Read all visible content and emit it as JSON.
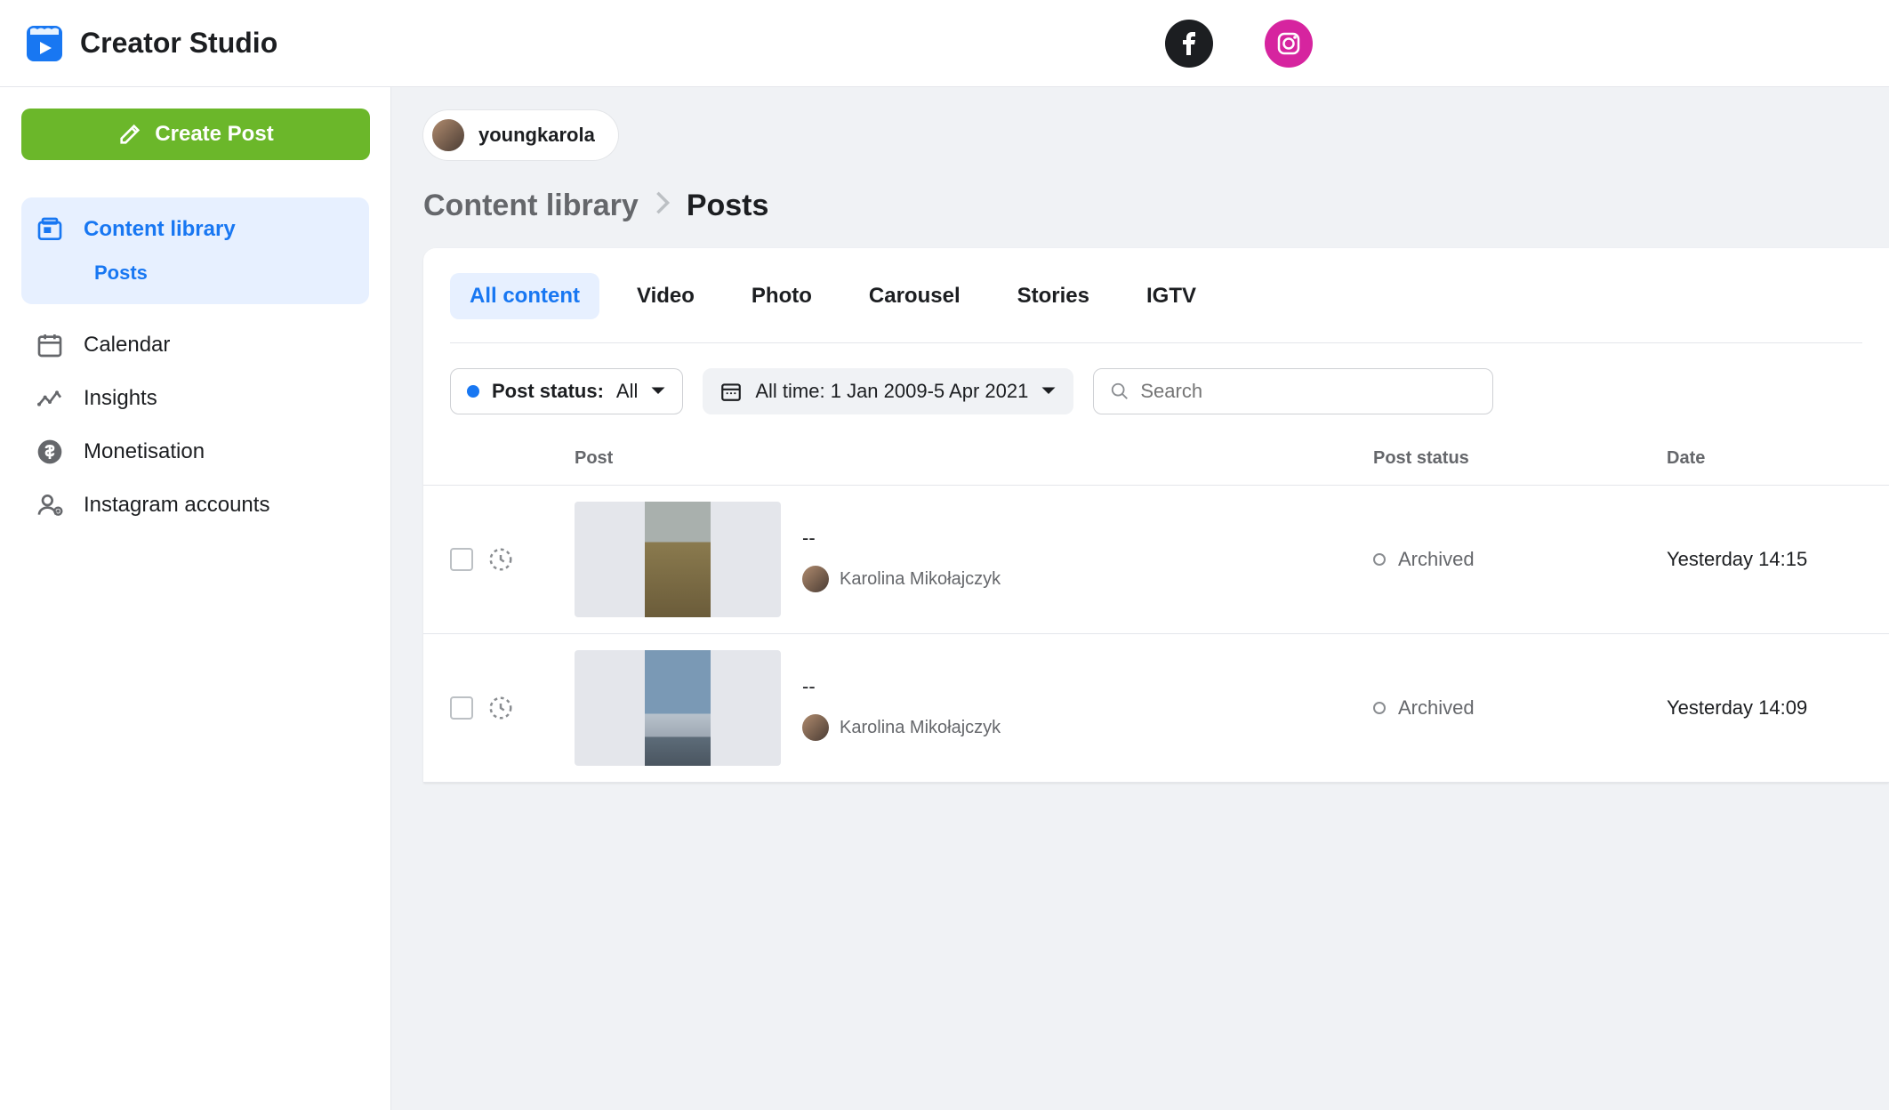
{
  "brand": {
    "title": "Creator Studio"
  },
  "topnav": {
    "facebook": "facebook-icon",
    "instagram": "instagram-icon"
  },
  "sidebar": {
    "create_label": "Create Post",
    "items": [
      {
        "label": "Content library",
        "active": true,
        "sub": "Posts"
      },
      {
        "label": "Calendar"
      },
      {
        "label": "Insights"
      },
      {
        "label": "Monetisation"
      },
      {
        "label": "Instagram accounts"
      }
    ]
  },
  "account": {
    "name": "youngkarola"
  },
  "breadcrumb": {
    "parent": "Content library",
    "current": "Posts"
  },
  "tabs": [
    "All content",
    "Video",
    "Photo",
    "Carousel",
    "Stories",
    "IGTV"
  ],
  "filters": {
    "status_label": "Post status:",
    "status_value": "All",
    "date_value": "All time: 1 Jan 2009-5 Apr 2021",
    "search_placeholder": "Search"
  },
  "table": {
    "columns": {
      "post": "Post",
      "status": "Post status",
      "date": "Date"
    },
    "rows": [
      {
        "title": "--",
        "author": "Karolina Mikołajczyk",
        "status": "Archived",
        "date": "Yesterday 14:15",
        "thumb": "field"
      },
      {
        "title": "--",
        "author": "Karolina Mikołajczyk",
        "status": "Archived",
        "date": "Yesterday 14:09",
        "thumb": "beach"
      }
    ]
  }
}
